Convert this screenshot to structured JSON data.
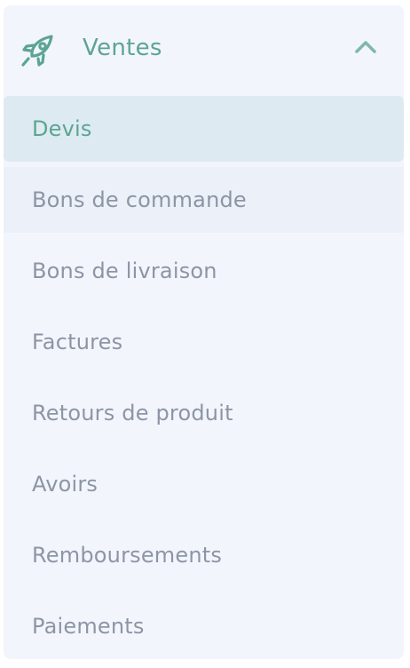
{
  "menu": {
    "section": {
      "title": "Ventes",
      "icon": "rocket-icon",
      "toggle_icon": "chevron-up-icon",
      "expanded": true
    },
    "items": [
      {
        "label": "Devis",
        "state": "active"
      },
      {
        "label": "Bons de commande",
        "state": "hover"
      },
      {
        "label": "Bons de livraison",
        "state": "normal"
      },
      {
        "label": "Factures",
        "state": "normal"
      },
      {
        "label": "Retours de produit",
        "state": "normal"
      },
      {
        "label": "Avoirs",
        "state": "normal"
      },
      {
        "label": "Remboursements",
        "state": "normal"
      },
      {
        "label": "Paiements",
        "state": "normal"
      }
    ]
  },
  "colors": {
    "accent": "#5ba592",
    "text": "#8d95a5",
    "panel_bg": "#f3f5fd",
    "active_bg": "#deeaf2",
    "hover_bg": "#ecf0f8"
  }
}
